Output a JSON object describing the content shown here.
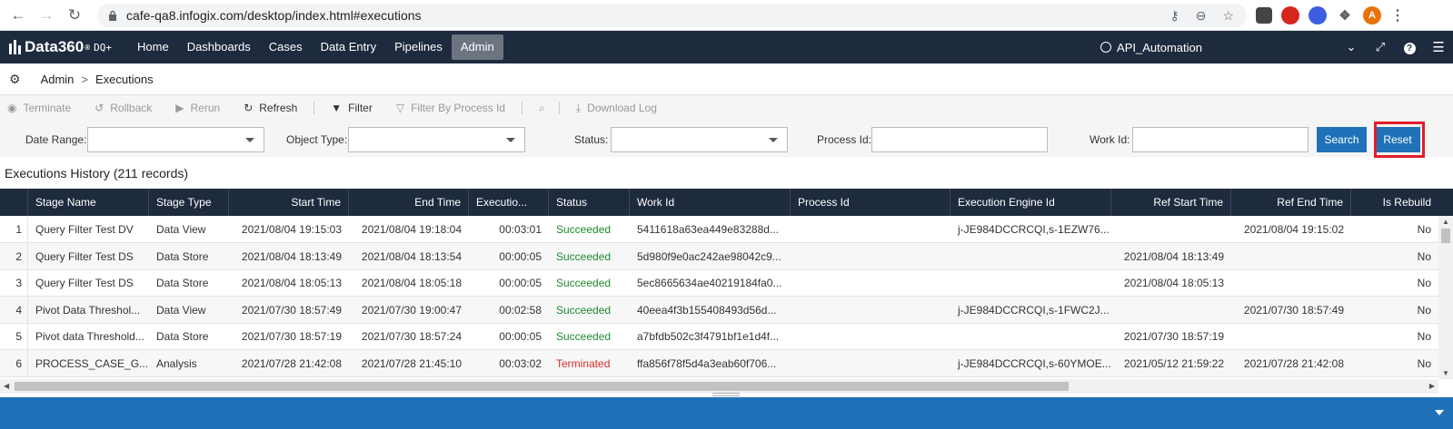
{
  "browser": {
    "url": "cafe-qa8.infogix.com/desktop/index.html#executions",
    "avatar_letter": "A"
  },
  "header": {
    "logo": "Data360",
    "logo_reg": "®",
    "logo_sub": "DQ+",
    "nav": [
      "Home",
      "Dashboards",
      "Cases",
      "Data Entry",
      "Pipelines",
      "Admin"
    ],
    "active_nav": "Admin",
    "user": "API_Automation"
  },
  "breadcrumb": {
    "root": "Admin",
    "separator": ">",
    "current": "Executions"
  },
  "toolbar": {
    "terminate": "Terminate",
    "rollback": "Rollback",
    "rerun": "Rerun",
    "refresh": "Refresh",
    "filter": "Filter",
    "filter_by_process": "Filter By Process Id",
    "download_log": "Download Log"
  },
  "filters": {
    "date_range_label": "Date Range:",
    "object_type_label": "Object Type:",
    "status_label": "Status:",
    "process_id_label": "Process Id:",
    "work_id_label": "Work Id:",
    "search_button": "Search",
    "reset_button": "Reset"
  },
  "history": {
    "title": "Executions History (211 records)"
  },
  "grid": {
    "columns": [
      "Stage Name",
      "Stage Type",
      "Start Time",
      "End Time",
      "Executio...",
      "Status",
      "Work Id",
      "Process Id",
      "Execution Engine Id",
      "Ref Start Time",
      "Ref End Time",
      "Is Rebuild"
    ],
    "rows": [
      {
        "n": "1",
        "stage": "Query Filter Test DV",
        "type": "Data View",
        "start": "2021/08/04 19:15:03",
        "end": "2021/08/04 19:18:04",
        "exec": "00:03:01",
        "status": "Succeeded",
        "work": "5411618a63ea449e83288d...",
        "process": "",
        "engine": "j-JE984DCCRCQI,s-1EZW76...",
        "ref_start": "",
        "ref_end": "2021/08/04 19:15:02",
        "rebuild": "No"
      },
      {
        "n": "2",
        "stage": "Query Filter Test DS",
        "type": "Data Store",
        "start": "2021/08/04 18:13:49",
        "end": "2021/08/04 18:13:54",
        "exec": "00:00:05",
        "status": "Succeeded",
        "work": "5d980f9e0ac242ae98042c9...",
        "process": "",
        "engine": "",
        "ref_start": "2021/08/04 18:13:49",
        "ref_end": "",
        "rebuild": "No"
      },
      {
        "n": "3",
        "stage": "Query Filter Test DS",
        "type": "Data Store",
        "start": "2021/08/04 18:05:13",
        "end": "2021/08/04 18:05:18",
        "exec": "00:00:05",
        "status": "Succeeded",
        "work": "5ec8665634ae40219184fa0...",
        "process": "",
        "engine": "",
        "ref_start": "2021/08/04 18:05:13",
        "ref_end": "",
        "rebuild": "No"
      },
      {
        "n": "4",
        "stage": "Pivot Data Threshol...",
        "type": "Data View",
        "start": "2021/07/30 18:57:49",
        "end": "2021/07/30 19:00:47",
        "exec": "00:02:58",
        "status": "Succeeded",
        "work": "40eea4f3b155408493d56d...",
        "process": "",
        "engine": "j-JE984DCCRCQI,s-1FWC2J...",
        "ref_start": "",
        "ref_end": "2021/07/30 18:57:49",
        "rebuild": "No"
      },
      {
        "n": "5",
        "stage": "Pivot data Threshold...",
        "type": "Data Store",
        "start": "2021/07/30 18:57:19",
        "end": "2021/07/30 18:57:24",
        "exec": "00:00:05",
        "status": "Succeeded",
        "work": "a7bfdb502c3f4791bf1e1d4f...",
        "process": "",
        "engine": "",
        "ref_start": "2021/07/30 18:57:19",
        "ref_end": "",
        "rebuild": "No"
      },
      {
        "n": "6",
        "stage": "PROCESS_CASE_G...",
        "type": "Analysis",
        "start": "2021/07/28 21:42:08",
        "end": "2021/07/28 21:45:10",
        "exec": "00:03:02",
        "status": "Terminated",
        "work": "ffa856f78f5d4a3eab60f706...",
        "process": "",
        "engine": "j-JE984DCCRCQI,s-60YMOE...",
        "ref_start": "2021/05/12 21:59:22",
        "ref_end": "2021/07/28 21:42:08",
        "rebuild": "No"
      }
    ]
  },
  "colors": {
    "header_bg": "#1e2a3e",
    "accent_blue": "#1f72b8",
    "success": "#1e8a2e",
    "terminated": "#d92b2b",
    "highlight": "#e01e2a"
  }
}
